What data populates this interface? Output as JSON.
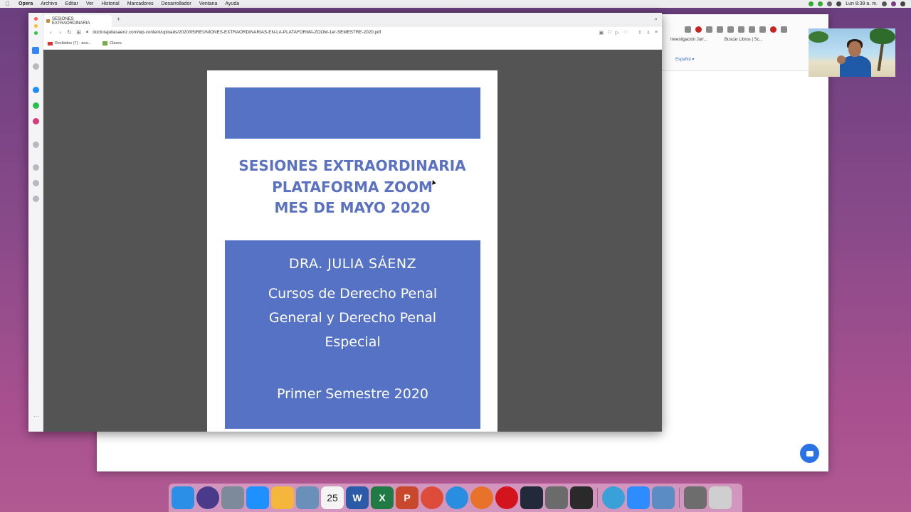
{
  "menubar": {
    "app": "Opera",
    "items": [
      "Archivo",
      "Editar",
      "Ver",
      "Historial",
      "Marcadores",
      "Desarrollador",
      "Ventana",
      "Ayuda"
    ],
    "clock": "Lun 8:39 a. m."
  },
  "browser": {
    "tab_title": "SESIONES EXTRAORDINARIA",
    "url": "doctorajuliasaenz.com/wp-content/uploads/2020/05/REUNIONES-EXTRAORDINARIAS-EN-LA-PLATAFORMA-ZOOM-1er-SEMESTRE-2020.pdf",
    "bookmarks": [
      "Recibidos (7) - ana...",
      "Clases"
    ]
  },
  "background_window": {
    "bookmarks": [
      "Investigación Jurí...",
      "Buscar Libros | Sc..."
    ],
    "language": "Español ▾"
  },
  "pdf": {
    "title_lines": [
      "SESIONES EXTRAORDINARIA",
      "PLATAFORMA ZOOM",
      "MES DE MAYO 2020"
    ],
    "author": "DRA. JULIA SÁENZ",
    "course_lines": [
      "Cursos de Derecho Penal",
      "General y Derecho Penal",
      "Especial"
    ],
    "semester": "Primer Semestre 2020",
    "colors": {
      "band": "#5572c5",
      "title_text": "#5b72c2"
    }
  },
  "dock": {
    "apps": [
      {
        "name": "finder",
        "color": "#2b8fe8"
      },
      {
        "name": "siri",
        "color": "#4a3a8a"
      },
      {
        "name": "launchpad",
        "color": "#7d8a99"
      },
      {
        "name": "app-store",
        "color": "#1e90ff"
      },
      {
        "name": "photos",
        "color": "#f5b73b"
      },
      {
        "name": "preview",
        "color": "#6a8fb8"
      },
      {
        "name": "calendar",
        "color": "#f4f4f4",
        "label": "25"
      },
      {
        "name": "word",
        "color": "#2b5aa8",
        "label": "W"
      },
      {
        "name": "excel",
        "color": "#1f7a44",
        "label": "X"
      },
      {
        "name": "powerpoint",
        "color": "#c9482b",
        "label": "P"
      },
      {
        "name": "chrome",
        "color": "#dd4b39"
      },
      {
        "name": "safari",
        "color": "#2a8ee0"
      },
      {
        "name": "firefox",
        "color": "#e8722a"
      },
      {
        "name": "opera",
        "color": "#d4141c"
      },
      {
        "name": "quicktime",
        "color": "#222a3a"
      },
      {
        "name": "screenshot",
        "color": "#6b6b6b"
      },
      {
        "name": "printer",
        "color": "#2a2a2a"
      },
      {
        "name": "sep"
      },
      {
        "name": "webex",
        "color": "#3aa0d8"
      },
      {
        "name": "zoom",
        "color": "#2d8cff"
      },
      {
        "name": "documents",
        "color": "#5b8cc4"
      },
      {
        "name": "sep"
      },
      {
        "name": "downloads",
        "color": "#6d6d6d"
      },
      {
        "name": "trash",
        "color": "#cfcfcf"
      }
    ]
  }
}
